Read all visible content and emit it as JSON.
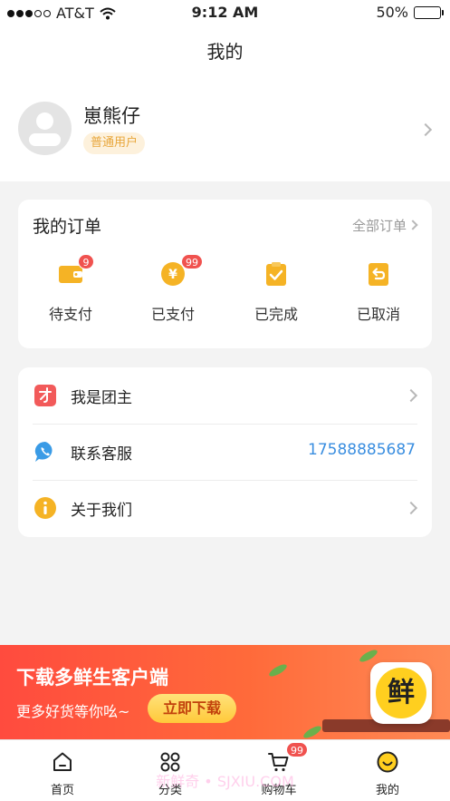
{
  "status_bar": {
    "carrier": "AT&T",
    "time": "9:12 AM",
    "battery": "50%",
    "battery_level": 0.5,
    "icons": [
      "signal-dots-icon",
      "wifi-icon",
      "battery-icon"
    ]
  },
  "nav": {
    "title": "我的"
  },
  "profile": {
    "name": "崽熊仔",
    "badge": "普通用户",
    "icons": [
      "avatar-placeholder-icon",
      "chevron-right-icon"
    ]
  },
  "orders": {
    "title": "我的订单",
    "view_all": "全部订单",
    "items": [
      {
        "label": "待支付",
        "icon": "wallet-icon",
        "badge": "9"
      },
      {
        "label": "已支付",
        "icon": "yen-coin-icon",
        "badge": "99"
      },
      {
        "label": "已完成",
        "icon": "clipboard-check-icon",
        "badge": ""
      },
      {
        "label": "已取消",
        "icon": "undo-icon",
        "badge": ""
      }
    ]
  },
  "menu": {
    "items": [
      {
        "label": "我是团主",
        "icon": "group-leader-icon",
        "value": ""
      },
      {
        "label": "联系客服",
        "icon": "chat-phone-icon",
        "value": "17588885687"
      },
      {
        "label": "关于我们",
        "icon": "info-icon",
        "value": ""
      }
    ]
  },
  "banner": {
    "title": "下载多鲜生客户端",
    "subtitle": "更多好货等你吆~",
    "button": "立即下载",
    "logo_text": "鲜"
  },
  "tabs": [
    {
      "label": "首页",
      "icon": "home-icon",
      "badge": ""
    },
    {
      "label": "分类",
      "icon": "category-icon",
      "badge": ""
    },
    {
      "label": "购物车",
      "icon": "cart-icon",
      "badge": "99"
    },
    {
      "label": "我的",
      "icon": "profile-smile-icon",
      "badge": ""
    }
  ],
  "watermark": "新鲜奇 • SJXIU.COM",
  "colors": {
    "accent_orange": "#f5b325",
    "badge_red": "#f0524f",
    "link_blue": "#3a8ee0",
    "banner_red": "#ff4b3e"
  }
}
